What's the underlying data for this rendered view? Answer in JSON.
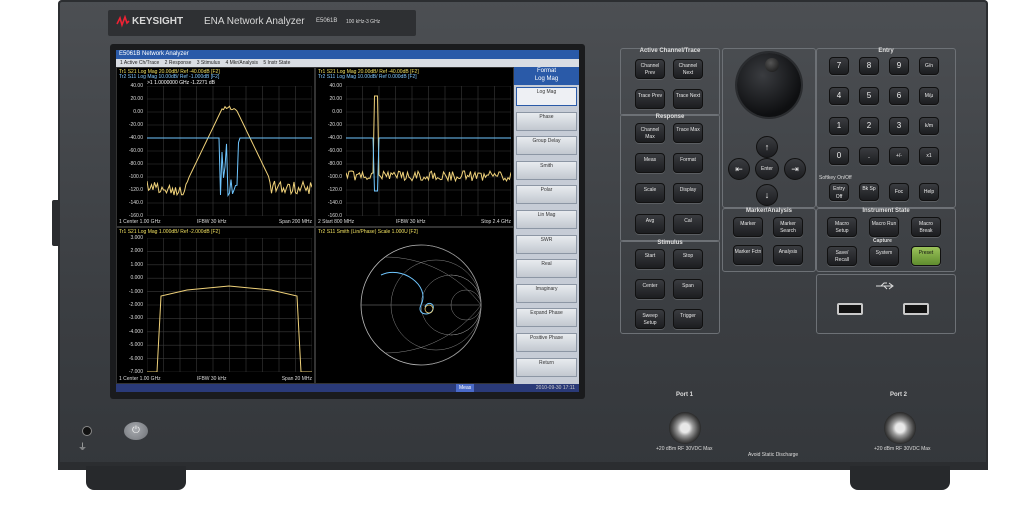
{
  "instrument": {
    "brand": "KEYSIGHT",
    "model_name": "ENA Network Analyzer",
    "model_number": "E5061B",
    "freq_range": "100 kHz-3 GHz"
  },
  "screen": {
    "window_title": "E5061B Network Analyzer",
    "menu": [
      "1 Active Ch/Trace",
      "2 Response",
      "3 Stimulus",
      "4 Mkr/Analysis",
      "5 Instr State"
    ],
    "status_left": "Meas",
    "status_right": "2010-09-30 17:11",
    "softkeys": {
      "title": "Format",
      "subtitle": "Log Mag",
      "items": [
        "Log Mag",
        "Phase",
        "Group Delay",
        "Smith",
        "Polar",
        "Lin Mag",
        "SWR",
        "Real",
        "Imaginary",
        "Expand Phase",
        "Positive Phase",
        "Return"
      ]
    },
    "panes": [
      {
        "hdr1": "Tr1 S21 Log Mag 20.00dB/ Ref -40.00dB [F2]",
        "hdr2": "Tr2 S11 Log Mag 10.00dB/ Ref -1.000dB [F2]",
        "marker": ">1  1.0000000 GHz -1.2271 dB",
        "yticks": [
          "40.00",
          "20.00",
          "0.00",
          "-20.00",
          "-40.00",
          "-60.00",
          "-80.00",
          "-100.0",
          "-120.0",
          "-140.0",
          "-160.0"
        ],
        "footer_l": "1 Center 1.00 GHz",
        "footer_m": "IFBW 30 kHz",
        "footer_r": "Span 200 MHz"
      },
      {
        "hdr1": "Tr1 S21 Log Mag 20.00dB/ Ref -40.00dB [F2]",
        "hdr2": "Tr2 S11 Log Mag 10.00dB/ Ref 0.000dB [F2]",
        "yticks": [
          "40.00",
          "20.00",
          "0.00",
          "-20.00",
          "-40.00",
          "-60.00",
          "-80.00",
          "-100.0",
          "-120.0",
          "-140.0",
          "-160.0"
        ],
        "footer_l": "2 Start 800 MHz",
        "footer_m": "IFBW 30 kHz",
        "footer_r": "Stop 2.4 GHz"
      },
      {
        "hdr1": "Tr1 S21 Log Mag 1.000dB/ Ref -2.000dB [F2]",
        "yticks": [
          "3.000",
          "2.000",
          "1.000",
          "0.000",
          "-1.000",
          "-2.000",
          "-3.000",
          "-4.000",
          "-5.000",
          "-6.000",
          "-7.000"
        ],
        "footer_l": "1 Center 1.00 GHz",
        "footer_m": "IFBW 30 kHz",
        "footer_r": "Span 20 MHz"
      },
      {
        "hdr1": "Tr2 S11 Smith (Lin/Phase) Scale 1.000U [F2]"
      }
    ]
  },
  "groups": {
    "active": {
      "title": "Active Channel/Trace",
      "buttons": [
        "Channel Prev",
        "Channel Next",
        "Trace Prev",
        "Trace Next"
      ]
    },
    "response": {
      "title": "Response",
      "buttons": [
        "Channel Max",
        "Trace Max",
        "Meas",
        "Format",
        "Scale",
        "Display",
        "Avg",
        "Cal"
      ]
    },
    "stimulus": {
      "title": "Stimulus",
      "buttons": [
        "Start",
        "Stop",
        "Center",
        "Span",
        "Sweep Setup",
        "Trigger"
      ]
    },
    "marker": {
      "title": "Marker/Analysis",
      "buttons": [
        "Marker",
        "Marker Search",
        "Marker Fctn",
        "Analysis"
      ]
    },
    "entry": {
      "title": "Entry",
      "keys": [
        "7",
        "8",
        "9",
        "G/n",
        "4",
        "5",
        "6",
        "M/μ",
        "1",
        "2",
        "3",
        "k/m",
        "0",
        ".",
        "+/-",
        "x1"
      ],
      "softbar": "Softkey On/Off",
      "bottom": [
        "Entry Off",
        "Bk Sp",
        "Foc",
        "Help"
      ]
    },
    "instr": {
      "title": "Instrument State",
      "buttons": [
        "Macro Setup",
        "Macro Run",
        "Macro Break"
      ],
      "capture": "Capture",
      "buttons2": [
        "Save/ Recall",
        "System",
        "Preset"
      ]
    },
    "nav": {
      "enter": "Enter",
      "up": "↑",
      "down": "↓",
      "left": "⇤",
      "right": "⇥"
    }
  },
  "ports": {
    "port1": "Port 1",
    "port2": "Port 2",
    "port1_warn": "+20 dBm RF 30VDC Max",
    "port2_warn": "+20 dBm RF 30VDC Max",
    "static": "Avoid Static Discharge"
  },
  "colors": {
    "trace1": "#f0d27a",
    "trace2": "#6fc6ff",
    "grid": "#3a3a3a",
    "screen_bg": "#000000",
    "preset": "#7aa844"
  }
}
